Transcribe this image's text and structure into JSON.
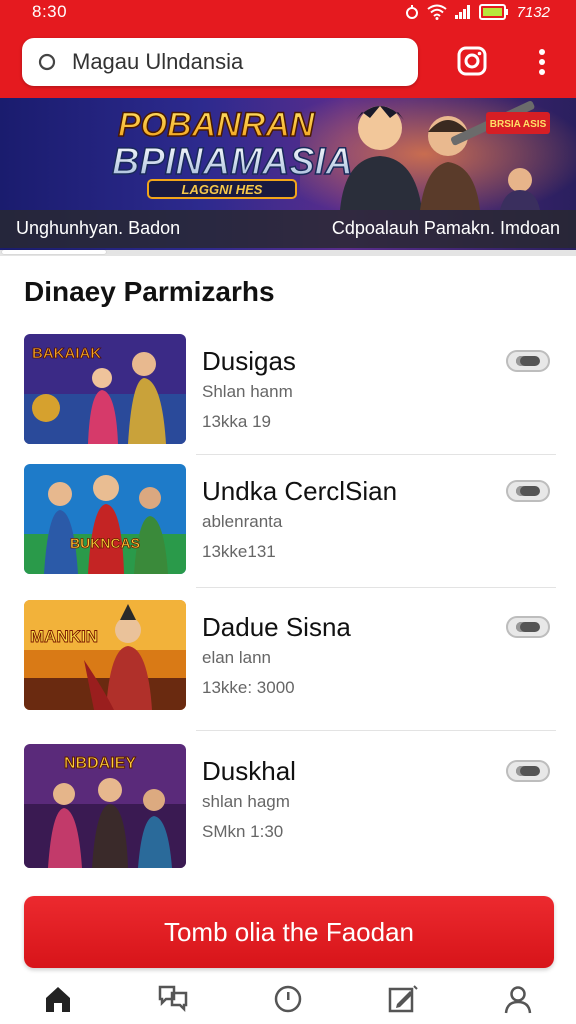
{
  "status": {
    "time": "8:30",
    "clock": "7132"
  },
  "search": {
    "value": "Magau Ulndansia",
    "placeholder": ""
  },
  "banner": {
    "title_line1": "POBANRAN",
    "title_line2": "BPINAMASIA",
    "ribbon": "LAGGNI HES",
    "badge": "BRSIA ASIS",
    "caption_left": "Unghunhyan. Badon",
    "caption_right": "Cdpoalauh Pamakn. Imdoan"
  },
  "section": {
    "title": "Dinaey Parmizarhs"
  },
  "items": [
    {
      "name": "Dusigas",
      "subtitle": "Shlan hanm",
      "meta": "13kka 19",
      "art_text": "BAKAIAK"
    },
    {
      "name": "Undka CerclSian",
      "subtitle": "ablenranta",
      "meta": "13kke131",
      "art_text": "BUKNCAS"
    },
    {
      "name": "Dadue Sisna",
      "subtitle": "elan lann",
      "meta": "13kke: 3000",
      "art_text": "MANKIN"
    },
    {
      "name": "Duskhal",
      "subtitle": "shlan hagm",
      "meta": "SMkn 1:30",
      "art_text": "NBDAIEY"
    }
  ],
  "cta": {
    "label": "Tomb olia the Faodan"
  },
  "nav": [
    "home-icon",
    "chat-icon",
    "circle-icon",
    "edit-icon",
    "profile-icon"
  ],
  "colors": {
    "brand": "#e51a1f",
    "cta": "#dc1a1f",
    "text": "#111111",
    "muted": "#666666"
  }
}
